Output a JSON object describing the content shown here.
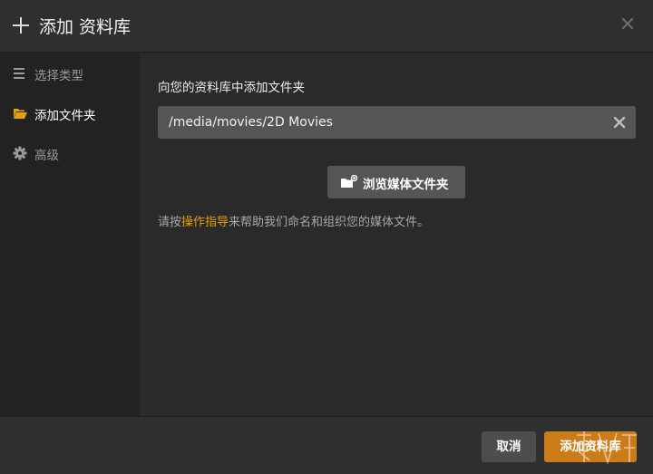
{
  "header": {
    "title": "添加 资料库",
    "close_icon": "close-icon"
  },
  "sidebar": {
    "items": [
      {
        "label": "选择类型",
        "icon": "lines-icon",
        "active": false
      },
      {
        "label": "添加文件夹",
        "icon": "folder-open-icon",
        "active": true
      },
      {
        "label": "高级",
        "icon": "gear-icon",
        "active": false
      }
    ]
  },
  "main": {
    "heading": "向您的资料库中添加文件夹",
    "path_value": "/media/movies/2D Movies",
    "browse_label": "浏览媒体文件夹",
    "help_prefix": "请按",
    "help_link": "操作指导",
    "help_suffix": "来帮助我们命名和组织您的媒体文件。"
  },
  "footer": {
    "cancel_label": "取消",
    "add_label": "添加资料库"
  },
  "colors": {
    "accent": "#e5a00d",
    "primary_button": "#cc7b19",
    "background": "#282828",
    "sidebar": "#222222"
  }
}
